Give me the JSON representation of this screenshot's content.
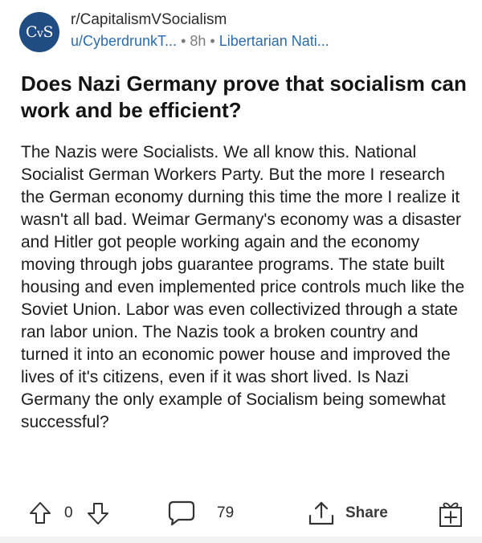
{
  "post": {
    "avatar_text": "CVS",
    "subreddit": "r/CapitalismVSocialism",
    "author": "u/CyberdrunkT...",
    "age": "8h",
    "flair": "Libertarian Nati...",
    "title": "Does Nazi Germany prove that socialism can work and be efficient?",
    "body": "The Nazis were Socialists. We all know this. National Socialist German Workers Party. But the more I research the German economy durning this time the more I realize it wasn't all bad. Weimar Germany's economy was a disaster and Hitler got people working again and the economy moving through jobs guarantee programs. The state built housing and even implemented price controls much like the Soviet Union. Labor was even collectivized through a state ran labor union. The Nazis took a broken country and turned it into an economic power house and improved the lives of it's citizens, even if it was short lived. Is Nazi Germany the only example of Socialism being somewhat successful?"
  },
  "actions": {
    "vote_count": "0",
    "comment_count": "79",
    "share_label": "Share",
    "icons": [
      "upvote-arrow-icon",
      "downvote-arrow-icon",
      "comment-bubble-icon",
      "share-icon",
      "award-gift-icon"
    ]
  },
  "colors": {
    "avatar_bg": "#1f4c82",
    "link_blue": "#2a6bb0",
    "muted_gray": "#7c7c7c"
  }
}
